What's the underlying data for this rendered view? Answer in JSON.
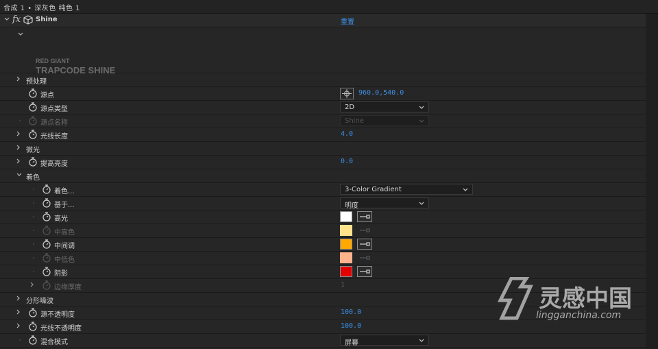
{
  "window": {
    "title": "合成 1 • 深灰色 纯色 1"
  },
  "effect": {
    "fx_label": "fx",
    "name": "Shine",
    "reset_label": "重置"
  },
  "logo": {
    "line1": "RED GIANT",
    "line2": "TRAPCODE SHINE"
  },
  "rows": {
    "preprocess": {
      "label": "预处理"
    },
    "source_point": {
      "label": "源点",
      "value": "960.0,540.0"
    },
    "source_type": {
      "label": "源点类型",
      "value": "2D"
    },
    "source_name": {
      "label": "源点名称",
      "value": "Shine"
    },
    "ray_length": {
      "label": "光线长度",
      "value": "4.0"
    },
    "shimmer": {
      "label": "微光"
    },
    "boost_light": {
      "label": "提高亮度",
      "value": "0.0"
    },
    "colorize_group": {
      "label": "着色"
    },
    "colorize": {
      "label": "着色...",
      "value": "3-Color Gradient"
    },
    "base_on": {
      "label": "基于...",
      "value": "明度"
    },
    "highlights": {
      "label": "高光",
      "color": "#ffffff"
    },
    "mid_high": {
      "label": "中高色",
      "color": "#ffe28c"
    },
    "midtones": {
      "label": "中间调",
      "color": "#ffa800"
    },
    "mid_low": {
      "label": "中低色",
      "color": "#ffb38c"
    },
    "shadows": {
      "label": "阴影",
      "color": "#e30000"
    },
    "edge_thickness": {
      "label": "边缘厚度",
      "value": "1"
    },
    "fractal_noise": {
      "label": "分形噪波"
    },
    "source_opacity": {
      "label": "源不透明度",
      "value": "100.0"
    },
    "ray_opacity": {
      "label": "光线不透明度",
      "value": "100.0"
    },
    "blend_mode": {
      "label": "混合模式",
      "value": "屏幕"
    }
  },
  "watermark": {
    "brand": "灵感中国",
    "url": "lingganchina.com"
  },
  "colors": {
    "accent": "#3c8fe6",
    "panel": "#262626"
  }
}
